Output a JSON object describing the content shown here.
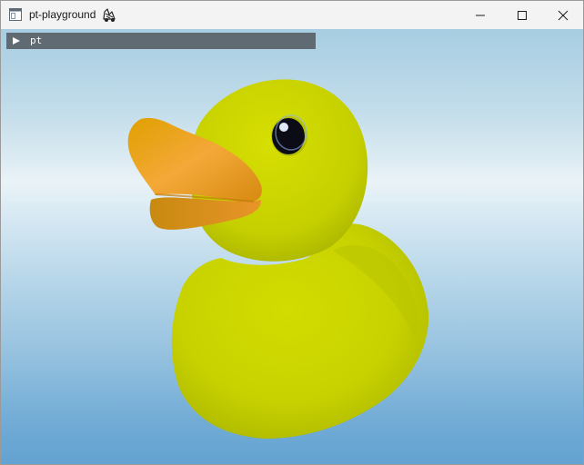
{
  "window": {
    "title": "pt-playground",
    "icons": {
      "app": "app-window-icon",
      "title_emoji": "racing-car-emoji-icon",
      "minimize": "minimize-icon",
      "maximize": "maximize-icon",
      "close": "close-icon"
    }
  },
  "panel": {
    "toggle_icon": "collapsed-triangle-icon",
    "label": "pt",
    "collapsed": true
  },
  "scene": {
    "object": "rubber-duck",
    "colors": {
      "body": "#c9d300",
      "beak": "#f0a020",
      "eye": "#0c0c16",
      "sky_top": "#a7cde2",
      "sky_bottom": "#63a2d1"
    }
  }
}
